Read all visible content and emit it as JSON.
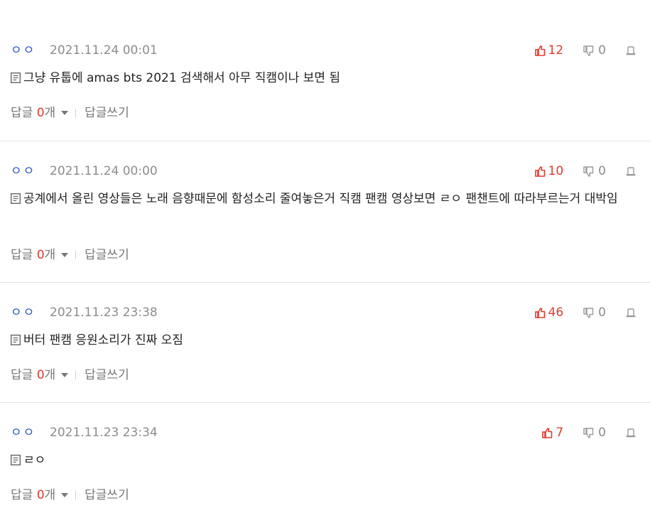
{
  "comments": [
    {
      "user": "ㅇㅇ",
      "date": "2021.11.24 00:01",
      "likes": "12",
      "dislikes": "0",
      "text": "그냥 유툽에 amas bts 2021 검색해서 아무 직캠이나 보면 됨",
      "reply_label": "답글",
      "reply_count": "0",
      "reply_unit": "개",
      "write_label": "답글쓰기"
    },
    {
      "user": "ㅇㅇ",
      "date": "2021.11.24 00:00",
      "likes": "10",
      "dislikes": "0",
      "text": "공계에서 올린 영상들은 노래 음향때문에 함성소리 줄여놓은거 직캠 팬캠 영상보면 ㄹㅇ 팬챈트에 따라부르는거 대박임",
      "reply_label": "답글",
      "reply_count": "0",
      "reply_unit": "개",
      "write_label": "답글쓰기"
    },
    {
      "user": "ㅇㅇ",
      "date": "2021.11.23 23:38",
      "likes": "46",
      "dislikes": "0",
      "text": "버터 팬캠 응원소리가 진짜 오짐",
      "reply_label": "답글",
      "reply_count": "0",
      "reply_unit": "개",
      "write_label": "답글쓰기"
    },
    {
      "user": "ㅇㅇ",
      "date": "2021.11.23 23:34",
      "likes": "7",
      "dislikes": "0",
      "text": "ㄹㅇ",
      "reply_label": "답글",
      "reply_count": "0",
      "reply_unit": "개",
      "write_label": "답글쓰기"
    }
  ],
  "colors": {
    "like": "#e23a2e",
    "user": "#2a56c6",
    "muted": "#8c8c8c",
    "text": "#222222"
  },
  "icons": {
    "like": "thumbs-up-icon",
    "dislike": "thumbs-down-icon",
    "report": "report-icon",
    "memo": "memo-icon",
    "caret": "caret-down-icon"
  }
}
